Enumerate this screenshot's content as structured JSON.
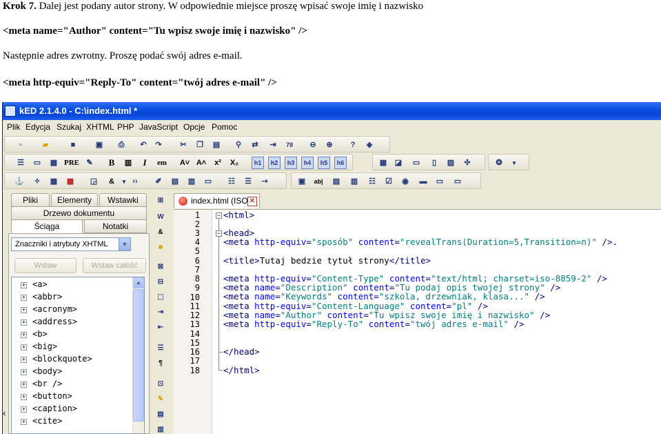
{
  "document": {
    "step_label": "Krok 7.",
    "line1_rest": " Dalej jest podany autor strony. W odpowiednie miejsce proszę wpisać swoje imię i nazwisko",
    "line2": "<meta name=\"Author\" content=\"Tu wpisz swoje imię i nazwisko\" />",
    "line3": "Następnie adres zwrotny. Proszę podać swój adres e-mail.",
    "line4": "<meta http-equiv=\"Reply-To\" content=\"twój adres e-mail\" />"
  },
  "window": {
    "title": "kED 2.1.4.0 - C:\\index.html *"
  },
  "menu": [
    "Plik",
    "Edycja",
    "Szukaj",
    "XHTML",
    "PHP",
    "JavaScript",
    "Opcje",
    "Pomoc"
  ],
  "toolbar2": {
    "pre_label": "PRE",
    "bold_label": "B",
    "italic_label": "I",
    "em_label": "em",
    "headings": [
      "h1",
      "h2",
      "h3",
      "h4",
      "h5",
      "h6"
    ]
  },
  "left_panel": {
    "tabs_top": [
      "Pliki",
      "Elementy",
      "Wstawki"
    ],
    "tab_tree": "Drzewo dokumentu",
    "tab_sciaga": "Ściąga",
    "tab_notatki": "Notatki",
    "dropdown_value": "Znaczniki i atrybuty XHTML",
    "btn_insert": "Wstaw",
    "btn_insert_all": "Wstaw całość",
    "tree_items": [
      "<a>",
      "<abbr>",
      "<acronym>",
      "<address>",
      "<b>",
      "<big>",
      "<blockquote>",
      "<body>",
      "<br />",
      "<button>",
      "<caption>",
      "<cite>"
    ]
  },
  "editor": {
    "tab_label": "index.html (ISO)",
    "line_numbers": [
      "1",
      "2",
      "3",
      "4",
      "5",
      "6",
      "7",
      "8",
      "9",
      "10",
      "11",
      "12",
      "13",
      "14",
      "15",
      "16",
      "17",
      "18"
    ],
    "lines": {
      "l1": "<html>",
      "l3": "<head>",
      "l4_tag": "<meta ",
      "l4_a1": "http-equiv",
      "l4_v1": "\"sposób\"",
      "l4_a2": "content",
      "l4_v2": "\"revealTrans(Duration=5,Transition=n)\"",
      "l4_end": " />.",
      "l6_open": "<title>",
      "l6_text": "Tutaj bedzie tytuł strony",
      "l6_close": "</title>",
      "l8_tag": "<meta ",
      "l8_a1": "http-equiv",
      "l8_v1": "\"Content-Type\"",
      "l8_a2": "content",
      "l8_v2": "\"text/html; charset=iso-8859-2\"",
      "l8_end": " />",
      "l9_tag": "<meta ",
      "l9_a1": "name",
      "l9_v1": "\"Description\"",
      "l9_a2": "content",
      "l9_v2": "\"Tu podaj opis twojej strony\"",
      "l9_end": " />",
      "l10_tag": "<meta ",
      "l10_a1": "name",
      "l10_v1": "\"Keywords\"",
      "l10_a2": "content",
      "l10_v2": "\"szkola, drzewniak, klasa...\"",
      "l10_end": " />",
      "l11_tag": "<meta ",
      "l11_a1": "http-equiv",
      "l11_v1": "\"Content-Language\"",
      "l11_a2": "content",
      "l11_v2": "\"pl\"",
      "l11_end": " />",
      "l12_tag": "<meta ",
      "l12_a1": "name",
      "l12_v1": "\"Author\"",
      "l12_a2": "content",
      "l12_v2": "\"Tu wpisz swoje imię i nazwisko\"",
      "l12_end": " />",
      "l13_tag": "<meta ",
      "l13_a1": "http-equiv",
      "l13_v1": "\"Reply-To\"",
      "l13_a2": "content",
      "l13_v2": "\"twój adres e-mail\"",
      "l13_end": " />",
      "l16": "</head>",
      "l18": "</html>"
    }
  }
}
